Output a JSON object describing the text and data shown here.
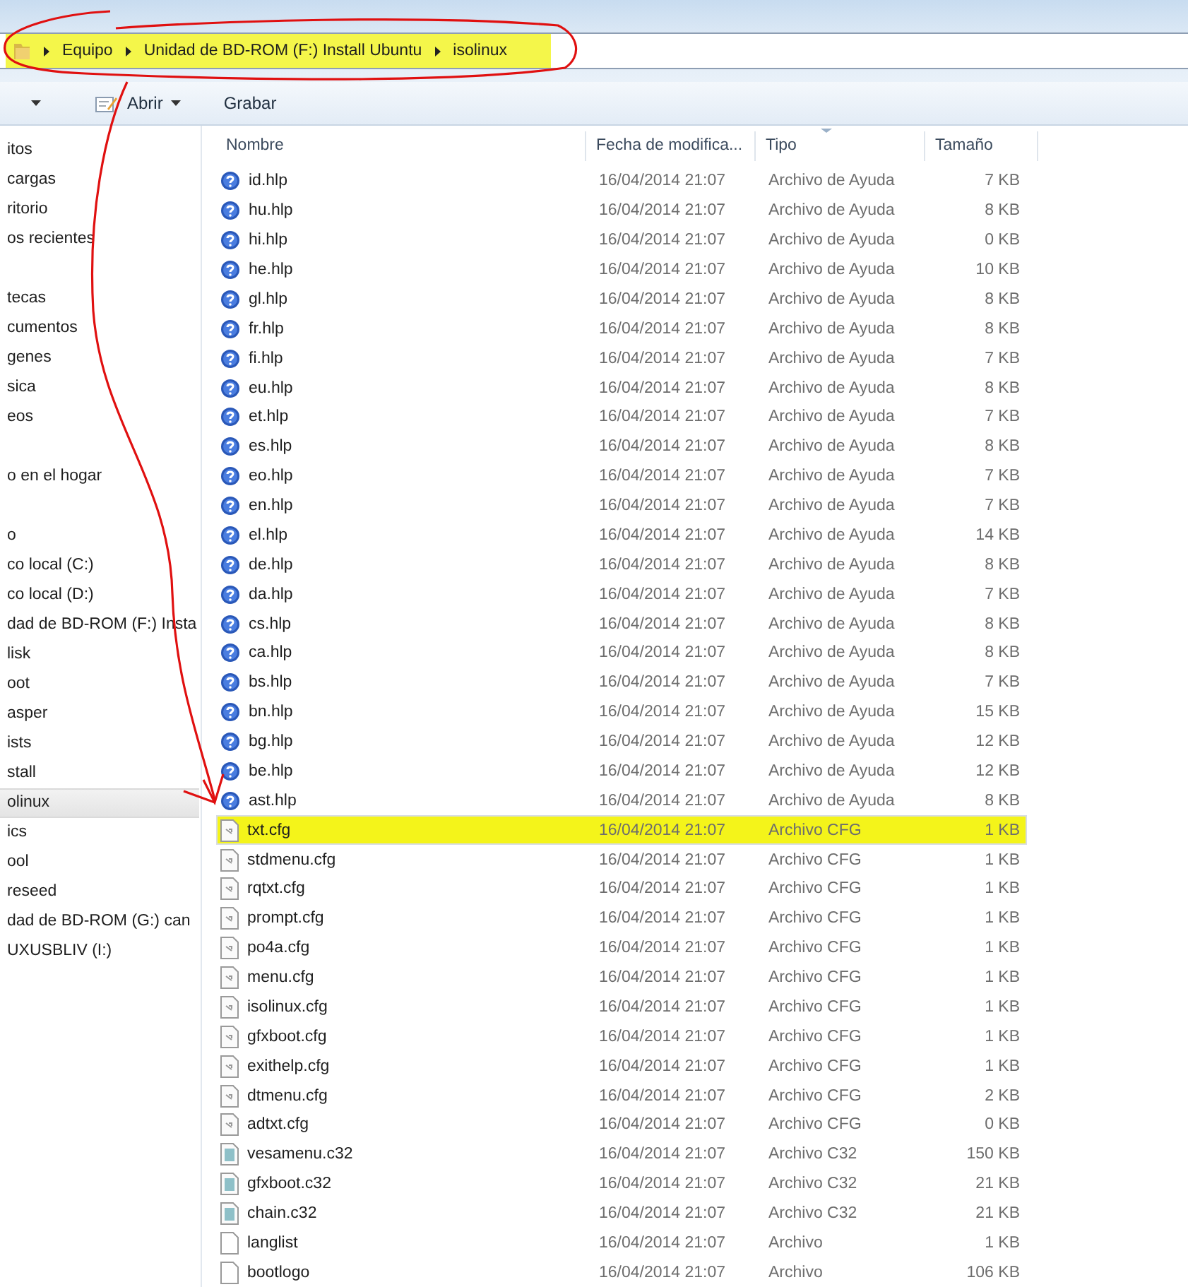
{
  "address_bar": {
    "highlighted": true,
    "crumbs": [
      "Equipo",
      "Unidad de BD-ROM (F:) Install Ubuntu",
      "isolinux"
    ]
  },
  "toolbar": {
    "buttons": [
      {
        "kind": "caret"
      },
      {
        "kind": "menu",
        "label": "Abrir"
      },
      {
        "kind": "plain",
        "label": "Grabar"
      }
    ]
  },
  "sidebar": {
    "groups": [
      {
        "items": [
          {
            "label": "itos",
            "selected": false
          },
          {
            "label": "cargas",
            "selected": false
          },
          {
            "label": "ritorio",
            "selected": false
          },
          {
            "label": "os recientes",
            "selected": false
          }
        ]
      },
      {
        "items": [
          {
            "label": "tecas",
            "selected": false
          },
          {
            "label": "cumentos",
            "selected": false
          },
          {
            "label": "genes",
            "selected": false
          },
          {
            "label": "sica",
            "selected": false
          },
          {
            "label": "eos",
            "selected": false
          }
        ]
      },
      {
        "items": [
          {
            "label": "o en el hogar",
            "selected": false
          }
        ]
      },
      {
        "items": [
          {
            "label": "o",
            "selected": false
          },
          {
            "label": "co local (C:)",
            "selected": false
          },
          {
            "label": "co local (D:)",
            "selected": false
          },
          {
            "label": "dad de BD-ROM (F:) Insta",
            "selected": false
          },
          {
            "label": "lisk",
            "selected": false
          },
          {
            "label": "oot",
            "selected": false
          },
          {
            "label": "asper",
            "selected": false
          },
          {
            "label": "ists",
            "selected": false
          },
          {
            "label": "stall",
            "selected": false
          },
          {
            "label": "olinux",
            "selected": true
          },
          {
            "label": "ics",
            "selected": false
          },
          {
            "label": "ool",
            "selected": false
          },
          {
            "label": "reseed",
            "selected": false
          },
          {
            "label": "dad de BD-ROM (G:) can",
            "selected": false
          },
          {
            "label": "UXUSBLIV (I:)",
            "selected": false
          }
        ]
      }
    ]
  },
  "table": {
    "columns": [
      "Nombre",
      "Fecha de modifica...",
      "Tipo",
      "Tamaño"
    ],
    "rows": [
      {
        "kind": "help",
        "name": "id.hlp",
        "date": "16/04/2014 21:07",
        "type": "Archivo de Ayuda",
        "size": "7 KB",
        "highlighted": false
      },
      {
        "kind": "help",
        "name": "hu.hlp",
        "date": "16/04/2014 21:07",
        "type": "Archivo de Ayuda",
        "size": "8 KB",
        "highlighted": false
      },
      {
        "kind": "help",
        "name": "hi.hlp",
        "date": "16/04/2014 21:07",
        "type": "Archivo de Ayuda",
        "size": "0 KB",
        "highlighted": false
      },
      {
        "kind": "help",
        "name": "he.hlp",
        "date": "16/04/2014 21:07",
        "type": "Archivo de Ayuda",
        "size": "10 KB",
        "highlighted": false
      },
      {
        "kind": "help",
        "name": "gl.hlp",
        "date": "16/04/2014 21:07",
        "type": "Archivo de Ayuda",
        "size": "8 KB",
        "highlighted": false
      },
      {
        "kind": "help",
        "name": "fr.hlp",
        "date": "16/04/2014 21:07",
        "type": "Archivo de Ayuda",
        "size": "8 KB",
        "highlighted": false
      },
      {
        "kind": "help",
        "name": "fi.hlp",
        "date": "16/04/2014 21:07",
        "type": "Archivo de Ayuda",
        "size": "7 KB",
        "highlighted": false
      },
      {
        "kind": "help",
        "name": "eu.hlp",
        "date": "16/04/2014 21:07",
        "type": "Archivo de Ayuda",
        "size": "8 KB",
        "highlighted": false
      },
      {
        "kind": "help",
        "name": "et.hlp",
        "date": "16/04/2014 21:07",
        "type": "Archivo de Ayuda",
        "size": "7 KB",
        "highlighted": false
      },
      {
        "kind": "help",
        "name": "es.hlp",
        "date": "16/04/2014 21:07",
        "type": "Archivo de Ayuda",
        "size": "8 KB",
        "highlighted": false
      },
      {
        "kind": "help",
        "name": "eo.hlp",
        "date": "16/04/2014 21:07",
        "type": "Archivo de Ayuda",
        "size": "7 KB",
        "highlighted": false
      },
      {
        "kind": "help",
        "name": "en.hlp",
        "date": "16/04/2014 21:07",
        "type": "Archivo de Ayuda",
        "size": "7 KB",
        "highlighted": false
      },
      {
        "kind": "help",
        "name": "el.hlp",
        "date": "16/04/2014 21:07",
        "type": "Archivo de Ayuda",
        "size": "14 KB",
        "highlighted": false
      },
      {
        "kind": "help",
        "name": "de.hlp",
        "date": "16/04/2014 21:07",
        "type": "Archivo de Ayuda",
        "size": "8 KB",
        "highlighted": false
      },
      {
        "kind": "help",
        "name": "da.hlp",
        "date": "16/04/2014 21:07",
        "type": "Archivo de Ayuda",
        "size": "7 KB",
        "highlighted": false
      },
      {
        "kind": "help",
        "name": "cs.hlp",
        "date": "16/04/2014 21:07",
        "type": "Archivo de Ayuda",
        "size": "8 KB",
        "highlighted": false
      },
      {
        "kind": "help",
        "name": "ca.hlp",
        "date": "16/04/2014 21:07",
        "type": "Archivo de Ayuda",
        "size": "8 KB",
        "highlighted": false
      },
      {
        "kind": "help",
        "name": "bs.hlp",
        "date": "16/04/2014 21:07",
        "type": "Archivo de Ayuda",
        "size": "7 KB",
        "highlighted": false
      },
      {
        "kind": "help",
        "name": "bn.hlp",
        "date": "16/04/2014 21:07",
        "type": "Archivo de Ayuda",
        "size": "15 KB",
        "highlighted": false
      },
      {
        "kind": "help",
        "name": "bg.hlp",
        "date": "16/04/2014 21:07",
        "type": "Archivo de Ayuda",
        "size": "12 KB",
        "highlighted": false
      },
      {
        "kind": "help",
        "name": "be.hlp",
        "date": "16/04/2014 21:07",
        "type": "Archivo de Ayuda",
        "size": "12 KB",
        "highlighted": false
      },
      {
        "kind": "help",
        "name": "ast.hlp",
        "date": "16/04/2014 21:07",
        "type": "Archivo de Ayuda",
        "size": "8 KB",
        "highlighted": false
      },
      {
        "kind": "cfg",
        "name": "txt.cfg",
        "date": "16/04/2014 21:07",
        "type": "Archivo CFG",
        "size": "1 KB",
        "highlighted": true
      },
      {
        "kind": "cfg",
        "name": "stdmenu.cfg",
        "date": "16/04/2014 21:07",
        "type": "Archivo CFG",
        "size": "1 KB",
        "highlighted": false
      },
      {
        "kind": "cfg",
        "name": "rqtxt.cfg",
        "date": "16/04/2014 21:07",
        "type": "Archivo CFG",
        "size": "1 KB",
        "highlighted": false
      },
      {
        "kind": "cfg",
        "name": "prompt.cfg",
        "date": "16/04/2014 21:07",
        "type": "Archivo CFG",
        "size": "1 KB",
        "highlighted": false
      },
      {
        "kind": "cfg",
        "name": "po4a.cfg",
        "date": "16/04/2014 21:07",
        "type": "Archivo CFG",
        "size": "1 KB",
        "highlighted": false
      },
      {
        "kind": "cfg",
        "name": "menu.cfg",
        "date": "16/04/2014 21:07",
        "type": "Archivo CFG",
        "size": "1 KB",
        "highlighted": false
      },
      {
        "kind": "cfg",
        "name": "isolinux.cfg",
        "date": "16/04/2014 21:07",
        "type": "Archivo CFG",
        "size": "1 KB",
        "highlighted": false
      },
      {
        "kind": "cfg",
        "name": "gfxboot.cfg",
        "date": "16/04/2014 21:07",
        "type": "Archivo CFG",
        "size": "1 KB",
        "highlighted": false
      },
      {
        "kind": "cfg",
        "name": "exithelp.cfg",
        "date": "16/04/2014 21:07",
        "type": "Archivo CFG",
        "size": "1 KB",
        "highlighted": false
      },
      {
        "kind": "cfg",
        "name": "dtmenu.cfg",
        "date": "16/04/2014 21:07",
        "type": "Archivo CFG",
        "size": "2 KB",
        "highlighted": false
      },
      {
        "kind": "cfg",
        "name": "adtxt.cfg",
        "date": "16/04/2014 21:07",
        "type": "Archivo CFG",
        "size": "0 KB",
        "highlighted": false
      },
      {
        "kind": "c32",
        "name": "vesamenu.c32",
        "date": "16/04/2014 21:07",
        "type": "Archivo C32",
        "size": "150 KB",
        "highlighted": false
      },
      {
        "kind": "c32",
        "name": "gfxboot.c32",
        "date": "16/04/2014 21:07",
        "type": "Archivo C32",
        "size": "21 KB",
        "highlighted": false
      },
      {
        "kind": "c32",
        "name": "chain.c32",
        "date": "16/04/2014 21:07",
        "type": "Archivo C32",
        "size": "21 KB",
        "highlighted": false
      },
      {
        "kind": "file",
        "name": "langlist",
        "date": "16/04/2014 21:07",
        "type": "Archivo",
        "size": "1 KB",
        "highlighted": false
      },
      {
        "kind": "file",
        "name": "bootlogo",
        "date": "16/04/2014 21:07",
        "type": "Archivo",
        "size": "106 KB",
        "highlighted": false
      }
    ]
  }
}
